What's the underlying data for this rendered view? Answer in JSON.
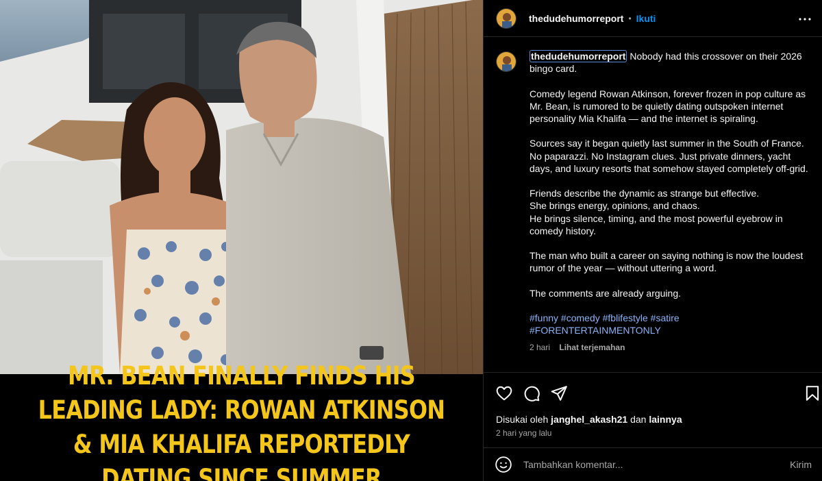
{
  "media": {
    "headline": "MR. BEAN FINALLY FINDS HIS LEADING LADY: ROWAN ATKINSON & MIA KHALIFA REPORTEDLY DATING SINCE SUMMER",
    "headline_color": "#f4c61b"
  },
  "header": {
    "username": "thedudehumorreport",
    "dot": "•",
    "follow_label": "Ikuti",
    "more_icon": "more-horizontal-icon"
  },
  "caption": {
    "username": "thedudehumorreport",
    "first_line": "Nobody had this crossover on their 2026 bingo card.",
    "paragraphs": [
      "Comedy legend Rowan Atkinson, forever frozen in pop culture as Mr. Bean, is rumored to be quietly dating outspoken internet personality Mia Khalifa — and the internet is spiraling.",
      "Sources say it began quietly last summer in the South of France. No paparazzi. No Instagram clues. Just private dinners, yacht days, and luxury resorts that somehow stayed completely off-grid.",
      "Friends describe the dynamic as strange but effective.",
      "She brings energy, opinions, and chaos.",
      "He brings silence, timing, and the most powerful eyebrow in comedy history.",
      "The man who built a career on saying nothing is now the loudest rumor of the year — without uttering a word.",
      "The comments are already arguing."
    ],
    "hashtags": "#funny #comedy #fblifestyle #satire #FORENTERTAINMENTONLY",
    "time": "2 hari",
    "translate_label": "Lihat terjemahan"
  },
  "actions": {
    "icons": [
      "heart-icon",
      "comment-icon",
      "share-icon",
      "bookmark-icon"
    ],
    "likes_prefix": "Disukai oleh",
    "likes_user": "janghel_akash21",
    "likes_and": "dan",
    "likes_others": "lainnya",
    "time_ago": "2 hari yang lalu"
  },
  "comment": {
    "placeholder": "Tambahkan komentar...",
    "post_label": "Kirim",
    "emoji_icon": "emoji-smile-icon"
  },
  "colors": {
    "background": "#000000",
    "link_blue": "#0095f6",
    "hashtag": "#8ab4f8",
    "muted": "#a8a8a8"
  }
}
